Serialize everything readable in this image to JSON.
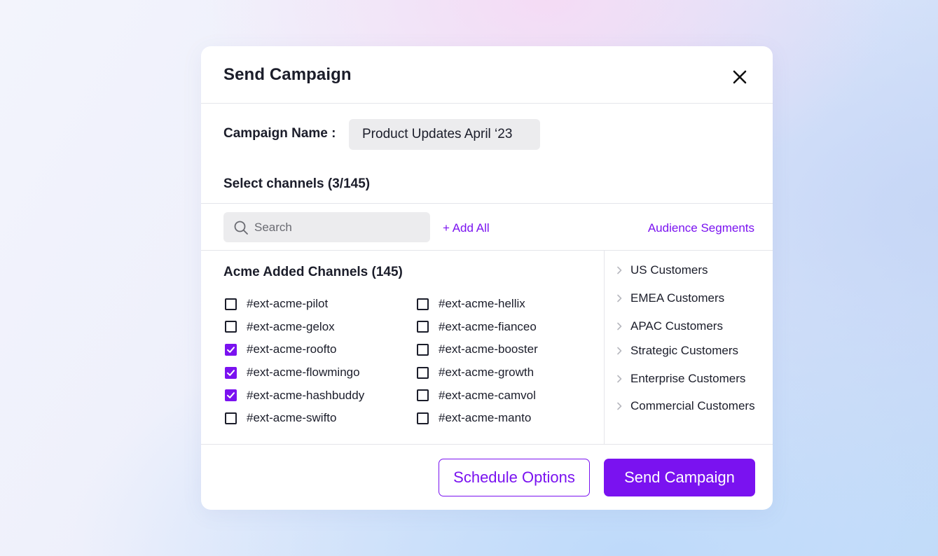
{
  "modal": {
    "title": "Send Campaign",
    "close_icon": "close-icon"
  },
  "campaign": {
    "name_label": "Campaign Name :",
    "name_value": "Product Updates April ‘23"
  },
  "channels_select": {
    "label": "Select channels (3/145)",
    "selected_count": 3,
    "total_count": 145
  },
  "toolbar": {
    "search_placeholder": "Search",
    "search_icon": "search-icon",
    "add_all": "+ Add All",
    "audience_segments": "Audience Segments"
  },
  "channels": {
    "heading": "Acme Added Channels (145)",
    "column1": [
      {
        "name": "#ext-acme-pilot",
        "checked": false
      },
      {
        "name": "#ext-acme-gelox",
        "checked": false
      },
      {
        "name": "#ext-acme-roofto",
        "checked": true
      },
      {
        "name": "#ext-acme-flowmingo",
        "checked": true
      },
      {
        "name": "#ext-acme-hashbuddy",
        "checked": true
      },
      {
        "name": "#ext-acme-swifto",
        "checked": false
      }
    ],
    "column2": [
      {
        "name": "#ext-acme-hellix",
        "checked": false
      },
      {
        "name": "#ext-acme-fianceo",
        "checked": false
      },
      {
        "name": "#ext-acme-booster",
        "checked": false
      },
      {
        "name": "#ext-acme-growth",
        "checked": false
      },
      {
        "name": "#ext-acme-camvol",
        "checked": false
      },
      {
        "name": "#ext-acme-manto",
        "checked": false
      }
    ]
  },
  "segments": [
    {
      "label": "US Customers"
    },
    {
      "label": "EMEA Customers"
    },
    {
      "label": "APAC Customers"
    },
    {
      "label": "Strategic Customers"
    },
    {
      "label": "Enterprise Customers"
    },
    {
      "label": "Commercial Customers"
    }
  ],
  "footer": {
    "schedule_options": "Schedule Options",
    "send_campaign": "Send Campaign"
  },
  "colors": {
    "accent": "#7a12f0",
    "text": "#1b1d2a",
    "field_bg": "#ececee",
    "divider": "#e4e5ea"
  }
}
